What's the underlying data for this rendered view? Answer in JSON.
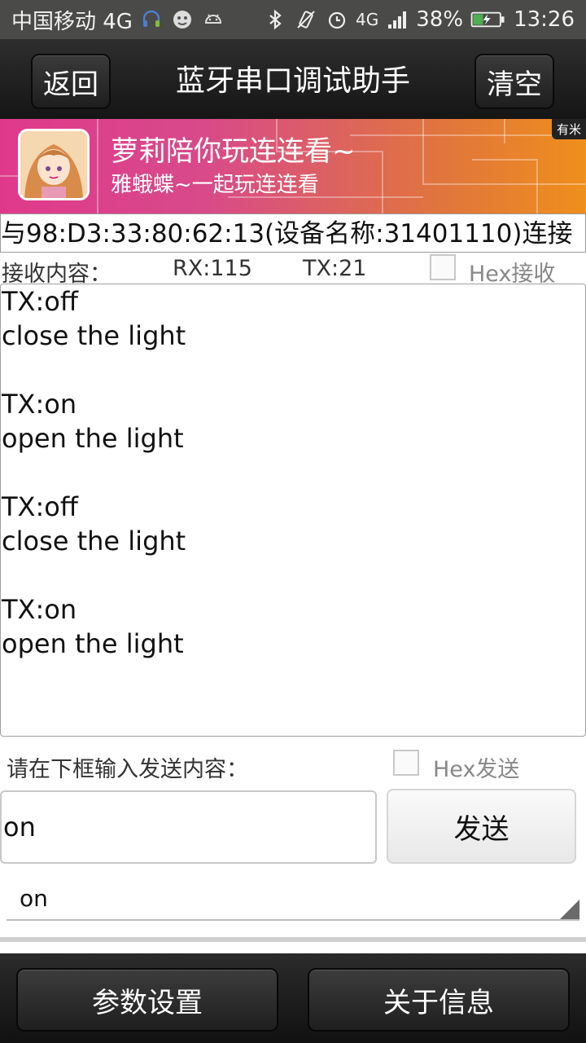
{
  "status_bar": {
    "carrier": "中国移动 4G",
    "battery": "38%",
    "time": "13:26",
    "network_type": "4G",
    "icons": [
      "headset-icon",
      "face-icon",
      "android-icon",
      "bluetooth-icon",
      "vibrate-icon",
      "alarm-icon",
      "signal-icon",
      "battery-icon"
    ],
    "battery_color": "#4caf50"
  },
  "title_bar": {
    "back_label": "返回",
    "title": "蓝牙串口调试助手",
    "clear_label": "清空"
  },
  "ad_banner": {
    "title": "萝莉陪你玩连连看~",
    "subtitle": "雅蛾蝶~一起玩连连看",
    "tag": "有米"
  },
  "connection": {
    "text": "与98:D3:33:80:62:13(设备名称:31401110)连接"
  },
  "receive": {
    "label": "接收内容：",
    "rx_count": "RX:115",
    "tx_count": "TX:21",
    "hex_label": "Hex接收",
    "hex_checked": false,
    "lines": [
      "TX:off",
      "close the light",
      "",
      "TX:on",
      "open the light",
      "",
      "TX:off",
      "close the light",
      "",
      "TX:on",
      "open the light"
    ]
  },
  "send": {
    "label": "请在下框输入发送内容：",
    "hex_label": "Hex发送",
    "hex_checked": false,
    "input_value": "on",
    "button_label": "发送",
    "history_value": "on"
  },
  "bottom_bar": {
    "params_label": "参数设置",
    "about_label": "关于信息"
  }
}
